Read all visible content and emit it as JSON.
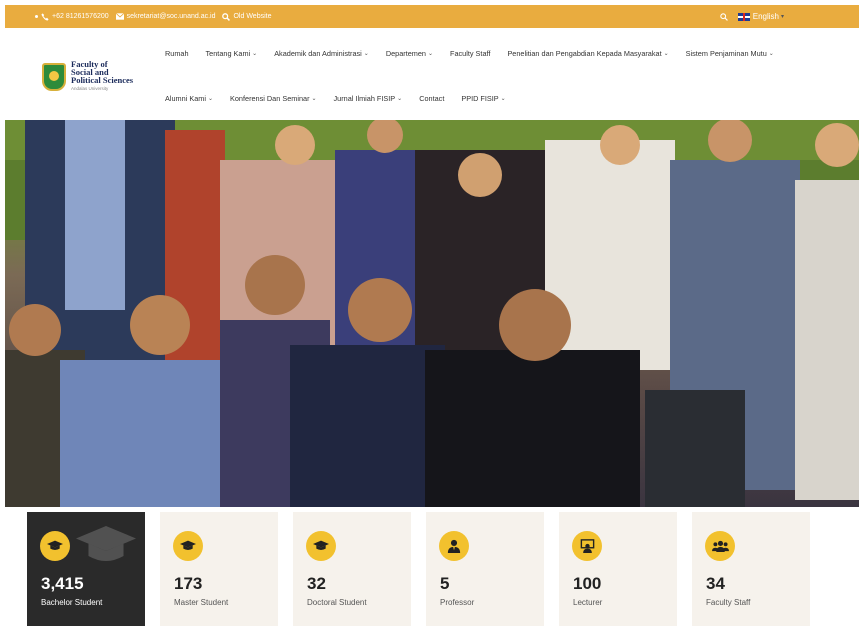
{
  "topbar": {
    "phone": "+62 81261576200",
    "email": "sekretariat@soc.unand.ac.id",
    "old_website": "Old Website",
    "language": "English"
  },
  "logo": {
    "line1": "Faculty of",
    "line2": "Social and",
    "line3": "Political Sciences",
    "sub": "Andalas University"
  },
  "nav": {
    "row1": [
      {
        "label": "Rumah",
        "dropdown": false
      },
      {
        "label": "Tentang Kami",
        "dropdown": true
      },
      {
        "label": "Akademik dan Administrasi",
        "dropdown": true
      },
      {
        "label": "Departemen",
        "dropdown": true
      },
      {
        "label": "Faculty Staff",
        "dropdown": false
      },
      {
        "label": "Penelitian dan Pengabdian Kepada Masyarakat",
        "dropdown": true
      },
      {
        "label": "Sistem Penjaminan Mutu",
        "dropdown": true
      }
    ],
    "row2": [
      {
        "label": "Alumni Kami",
        "dropdown": true
      },
      {
        "label": "Konferensi Dan Seminar",
        "dropdown": true
      },
      {
        "label": "Jurnal Ilmiah FISIP",
        "dropdown": true
      },
      {
        "label": "Contact",
        "dropdown": false
      },
      {
        "label": "PPID FISIP",
        "dropdown": true
      }
    ]
  },
  "stats": [
    {
      "value": "3,415",
      "label": "Bachelor Student",
      "icon": "graduation-cap-icon",
      "active": true
    },
    {
      "value": "173",
      "label": "Master Student",
      "icon": "graduation-cap-icon",
      "active": false
    },
    {
      "value": "32",
      "label": "Doctoral Student",
      "icon": "graduation-cap-icon",
      "active": false
    },
    {
      "value": "5",
      "label": "Professor",
      "icon": "user-tie-icon",
      "active": false
    },
    {
      "value": "100",
      "label": "Lecturer",
      "icon": "chalkboard-teacher-icon",
      "active": false
    },
    {
      "value": "34",
      "label": "Faculty Staff",
      "icon": "users-icon",
      "active": false
    }
  ],
  "colors": {
    "accent": "#e9ac3f",
    "icon_bg": "#f2c12e",
    "card_bg": "#f6f2ec",
    "card_active_bg": "#2a2a2a"
  }
}
